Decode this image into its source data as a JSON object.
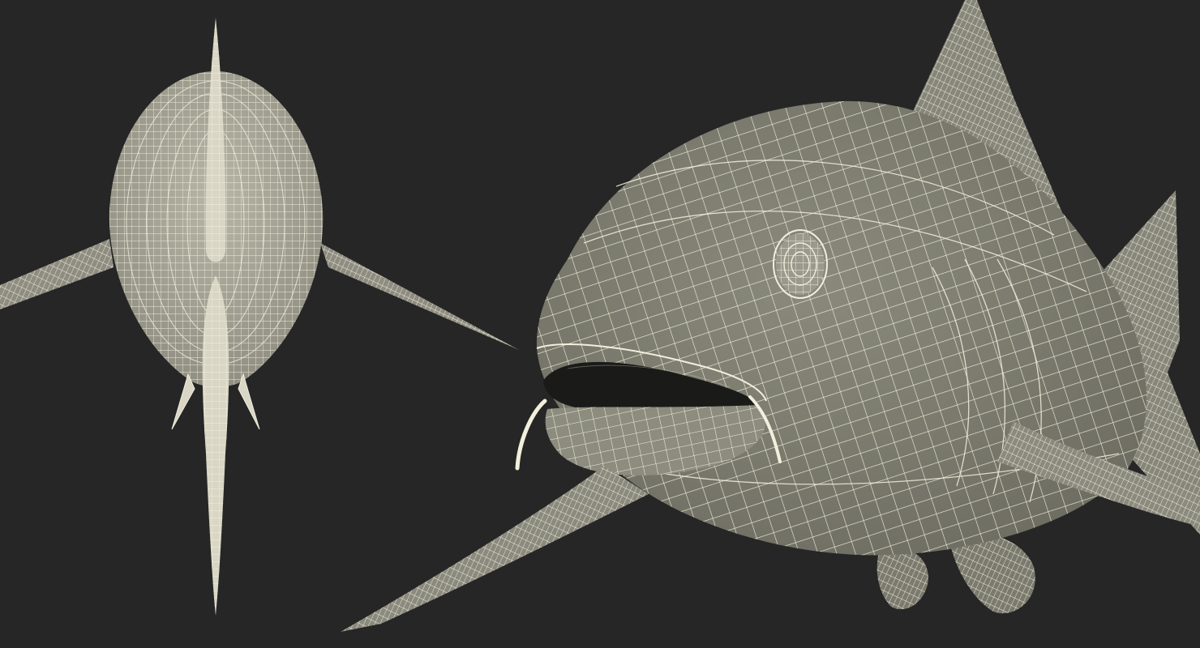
{
  "scene": {
    "background_color": "#262626",
    "wire_color": "#f2efdc",
    "surface_color": "#7f7f72",
    "surface_dark": "#5e5e54",
    "mouth_color": "#1a1a18",
    "views": [
      {
        "name": "front-view"
      },
      {
        "name": "three-quarter-view"
      }
    ]
  }
}
